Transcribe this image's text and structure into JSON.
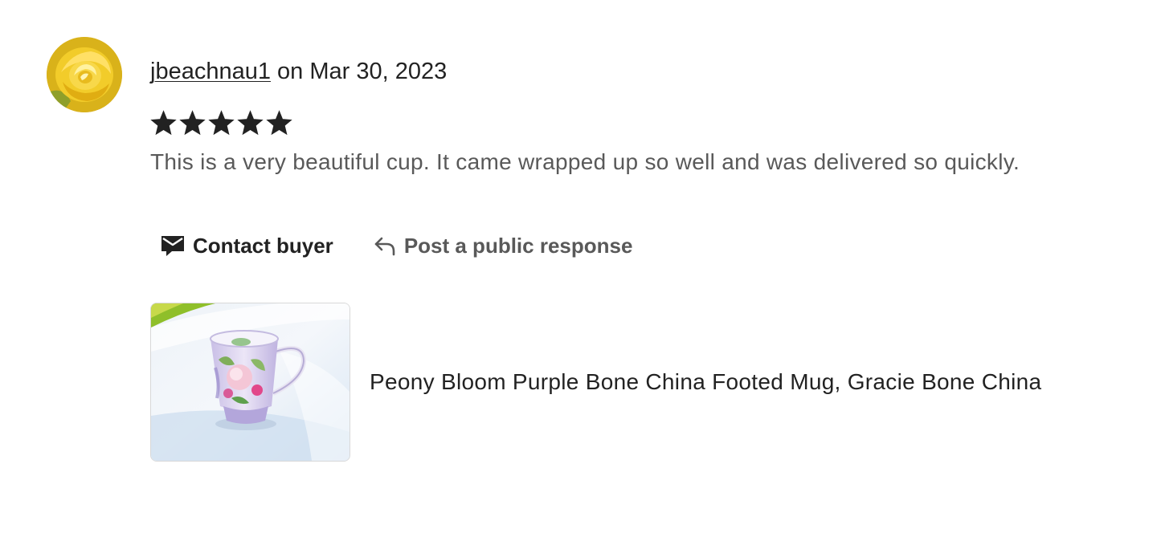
{
  "review": {
    "avatar_icon": "yellow-rose-avatar",
    "username": "jbeachnau1",
    "date_text": " on Mar 30, 2023",
    "rating": 5,
    "rating_max": 5,
    "text": "This is a very beautiful cup. It came wrapped up so well and was delivered so quickly."
  },
  "actions": {
    "contact_label": "Contact buyer",
    "contact_icon": "envelope-icon",
    "respond_label": "Post a public response",
    "respond_icon": "reply-arrow-icon"
  },
  "product": {
    "title": "Peony Bloom Purple Bone China Footed Mug, Gracie Bone China"
  },
  "colors": {
    "text_primary": "#222222",
    "text_secondary": "#595959",
    "star": "#222222"
  }
}
